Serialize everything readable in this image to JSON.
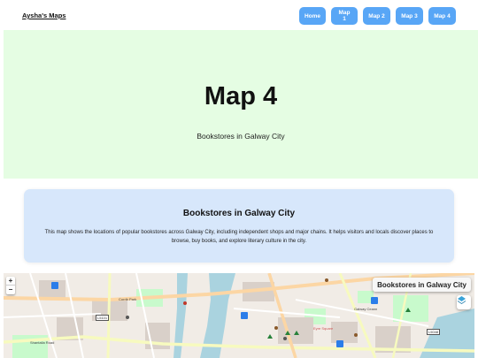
{
  "nav": {
    "brand": "Aysha's Maps",
    "buttons": [
      "Home",
      "Map 1",
      "Map 2",
      "Map 3",
      "Map 4"
    ]
  },
  "hero": {
    "title": "Map 4",
    "subtitle": "Bookstores in Galway City"
  },
  "card": {
    "title": "Bookstores in Galway City",
    "description": "This map shows the locations of popular bookstores across Galway City, including independent shops and major chains. It helps visitors and locals discover places to browse, buy books, and explore literary culture in the city."
  },
  "map": {
    "title": "Bookstores in Galway City",
    "zoom_in": "+",
    "zoom_out": "−",
    "labels": {
      "road_l5101": "L5101",
      "road_l5048": "L5048",
      "galway_central": "Galway Ceann",
      "eyre_square": "Eyre Square",
      "corrib_park": "Corrib Park",
      "shantalla": "Shantalla Road"
    },
    "colors": {
      "land": "#f1ece6",
      "water": "#aad3df",
      "park": "#c8facc",
      "road_major": "#f7fabf",
      "road_primary": "#fcd6a4",
      "building": "#d9d0c9"
    }
  }
}
